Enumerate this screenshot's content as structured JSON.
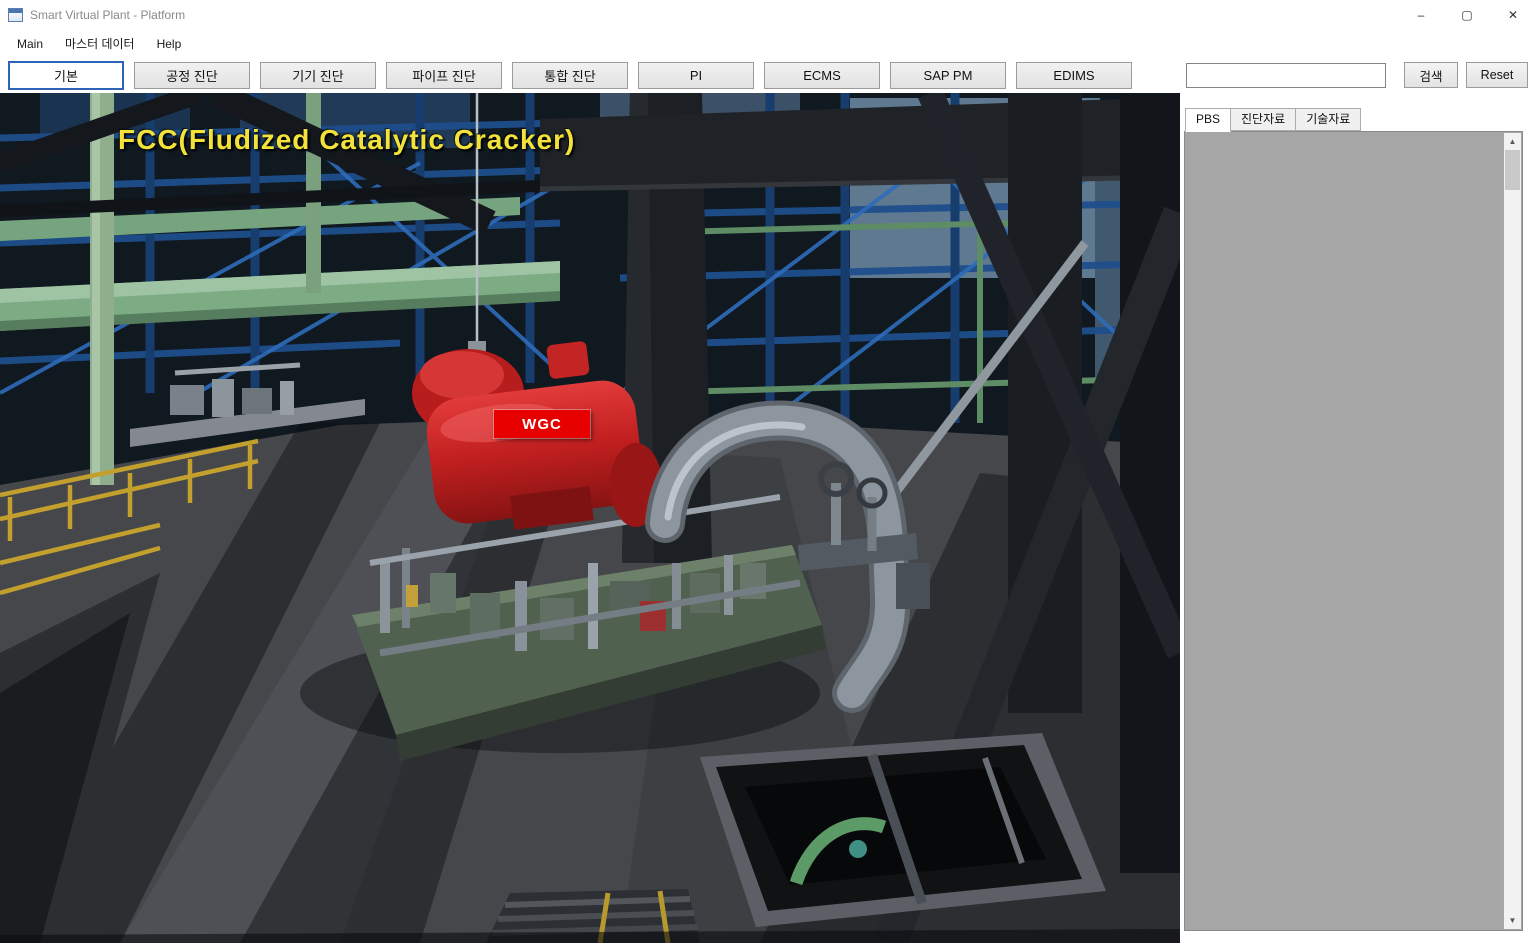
{
  "window": {
    "title": "Smart Virtual Plant - Platform",
    "controls": {
      "minimize": "–",
      "maximize": "▢",
      "close": "✕"
    }
  },
  "menu": {
    "items": [
      {
        "label": "Main"
      },
      {
        "label": "마스터 데이터"
      },
      {
        "label": "Help"
      }
    ]
  },
  "toolbar": {
    "buttons": [
      {
        "label": "기본"
      },
      {
        "label": "공정 진단"
      },
      {
        "label": "기기 진단"
      },
      {
        "label": "파이프 진단"
      },
      {
        "label": "통합 진단"
      },
      {
        "label": "PI"
      },
      {
        "label": "ECMS"
      },
      {
        "label": "SAP PM"
      },
      {
        "label": "EDIMS"
      }
    ],
    "active_button": "기본"
  },
  "search": {
    "value": "",
    "search_button": "검색",
    "reset_button": "Reset"
  },
  "side_panel": {
    "tabs": [
      {
        "label": "PBS"
      },
      {
        "label": "진단자료"
      },
      {
        "label": "기술자료"
      }
    ],
    "active_tab": "PBS",
    "scroll_icons": {
      "up": "▲",
      "down": "▼"
    }
  },
  "viewport": {
    "overlay_title": "FCC(Fludized Catalytic Cracker)",
    "equipment_label": "WGC"
  },
  "colors": {
    "accent_blue": "#2d64b8",
    "highlight_red": "#e60000",
    "overlay_yellow": "#f2e23a"
  }
}
